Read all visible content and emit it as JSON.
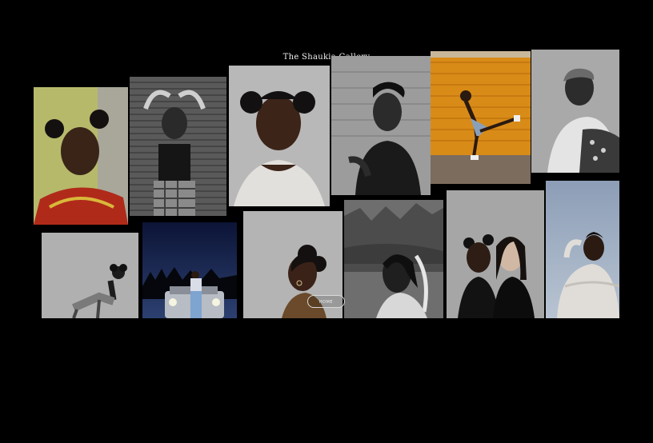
{
  "header": {
    "title": "The Shaukia Gallery"
  },
  "nav": {
    "home_label": "HOME"
  },
  "photos": [
    {
      "id": "p1",
      "icon": "portrait-red-dress"
    },
    {
      "id": "p2",
      "icon": "portrait-bw-plaid-skirt"
    },
    {
      "id": "p3",
      "icon": "portrait-white-top"
    },
    {
      "id": "p4",
      "icon": "portrait-black-tank"
    },
    {
      "id": "p5",
      "icon": "portrait-orange-wall"
    },
    {
      "id": "p6",
      "icon": "portrait-headwrap"
    },
    {
      "id": "p7",
      "icon": "portrait-seated-bw"
    },
    {
      "id": "p8",
      "icon": "portrait-night-car"
    },
    {
      "id": "p9",
      "icon": "portrait-profile-buns"
    },
    {
      "id": "p10",
      "icon": "portrait-bw-rocks"
    },
    {
      "id": "p11",
      "icon": "portrait-two-women"
    },
    {
      "id": "p12",
      "icon": "portrait-sky-sweater"
    }
  ]
}
